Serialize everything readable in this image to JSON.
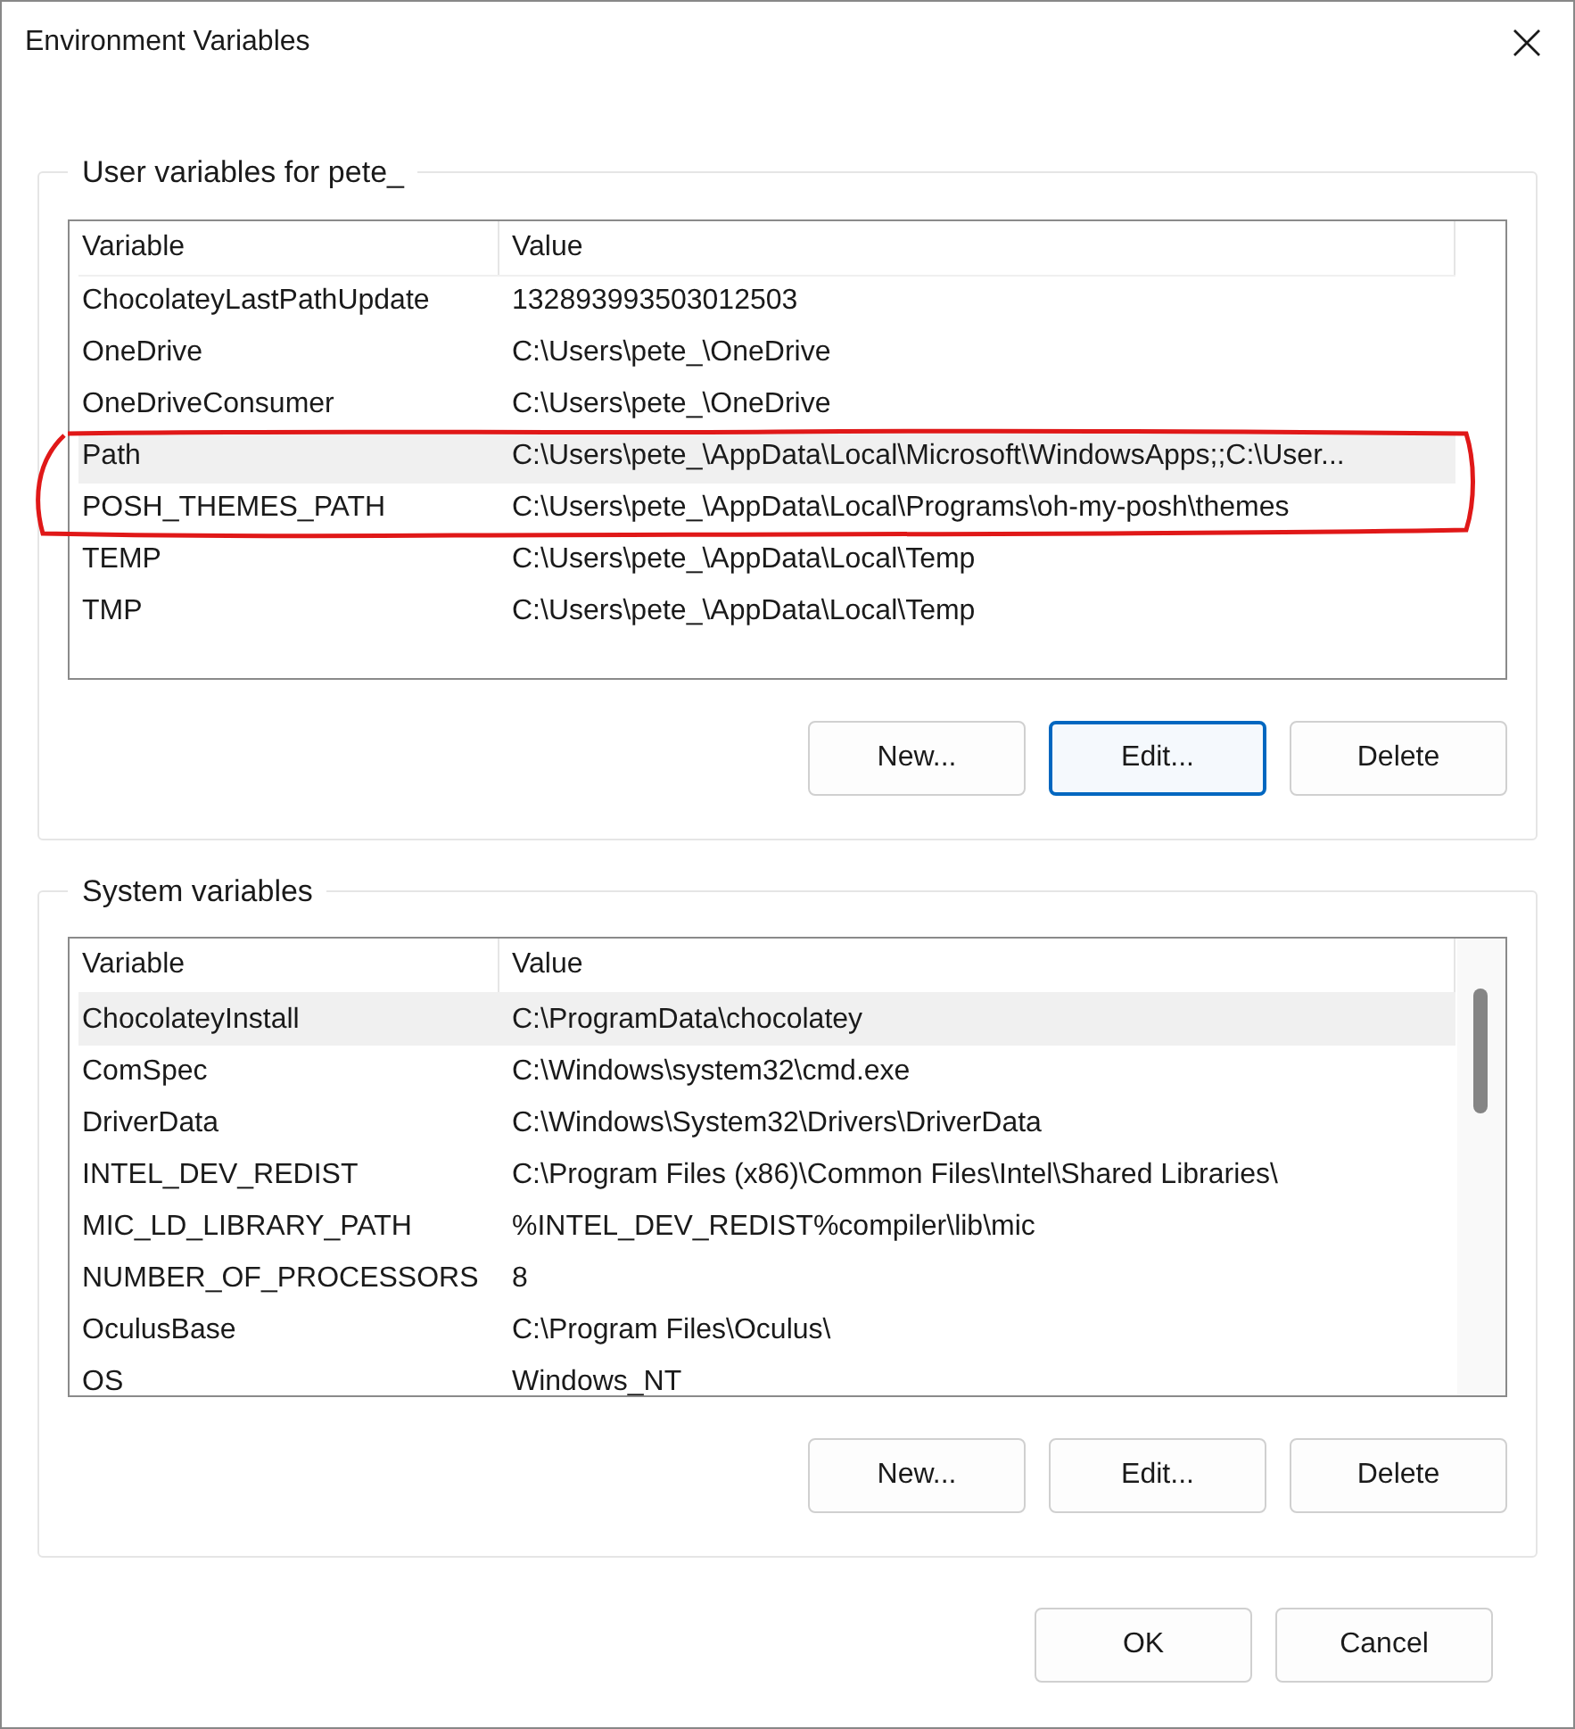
{
  "window": {
    "title": "Environment Variables"
  },
  "user_variables": {
    "label": "User variables for pete_",
    "columns": [
      "Variable",
      "Value"
    ],
    "scrollbar": false,
    "rows": [
      {
        "variable": "ChocolateyLastPathUpdate",
        "value": "132893993503012503",
        "selected": false
      },
      {
        "variable": "OneDrive",
        "value": "C:\\Users\\pete_\\OneDrive",
        "selected": false
      },
      {
        "variable": "OneDriveConsumer",
        "value": "C:\\Users\\pete_\\OneDrive",
        "selected": false
      },
      {
        "variable": "Path",
        "value": "C:\\Users\\pete_\\AppData\\Local\\Microsoft\\WindowsApps;;C:\\User...",
        "selected": true
      },
      {
        "variable": "POSH_THEMES_PATH",
        "value": "C:\\Users\\pete_\\AppData\\Local\\Programs\\oh-my-posh\\themes",
        "selected": false
      },
      {
        "variable": "TEMP",
        "value": "C:\\Users\\pete_\\AppData\\Local\\Temp",
        "selected": false
      },
      {
        "variable": "TMP",
        "value": "C:\\Users\\pete_\\AppData\\Local\\Temp",
        "selected": false
      }
    ],
    "buttons": [
      {
        "label": "New...",
        "focused": false
      },
      {
        "label": "Edit...",
        "focused": true
      },
      {
        "label": "Delete",
        "focused": false
      }
    ]
  },
  "system_variables": {
    "label": "System variables",
    "columns": [
      "Variable",
      "Value"
    ],
    "scrollbar": true,
    "rows": [
      {
        "variable": "ChocolateyInstall",
        "value": "C:\\ProgramData\\chocolatey",
        "selected": true
      },
      {
        "variable": "ComSpec",
        "value": "C:\\Windows\\system32\\cmd.exe",
        "selected": false
      },
      {
        "variable": "DriverData",
        "value": "C:\\Windows\\System32\\Drivers\\DriverData",
        "selected": false
      },
      {
        "variable": "INTEL_DEV_REDIST",
        "value": "C:\\Program Files (x86)\\Common Files\\Intel\\Shared Libraries\\",
        "selected": false
      },
      {
        "variable": "MIC_LD_LIBRARY_PATH",
        "value": "%INTEL_DEV_REDIST%compiler\\lib\\mic",
        "selected": false
      },
      {
        "variable": "NUMBER_OF_PROCESSORS",
        "value": "8",
        "selected": false
      },
      {
        "variable": "OculusBase",
        "value": "C:\\Program Files\\Oculus\\",
        "selected": false
      },
      {
        "variable": "OS",
        "value": "Windows_NT",
        "selected": false
      }
    ],
    "buttons": [
      {
        "label": "New...",
        "focused": false
      },
      {
        "label": "Edit...",
        "focused": false
      },
      {
        "label": "Delete",
        "focused": false
      }
    ]
  },
  "dialog_buttons": [
    {
      "label": "OK",
      "focused": false
    },
    {
      "label": "Cancel",
      "focused": false
    }
  ]
}
